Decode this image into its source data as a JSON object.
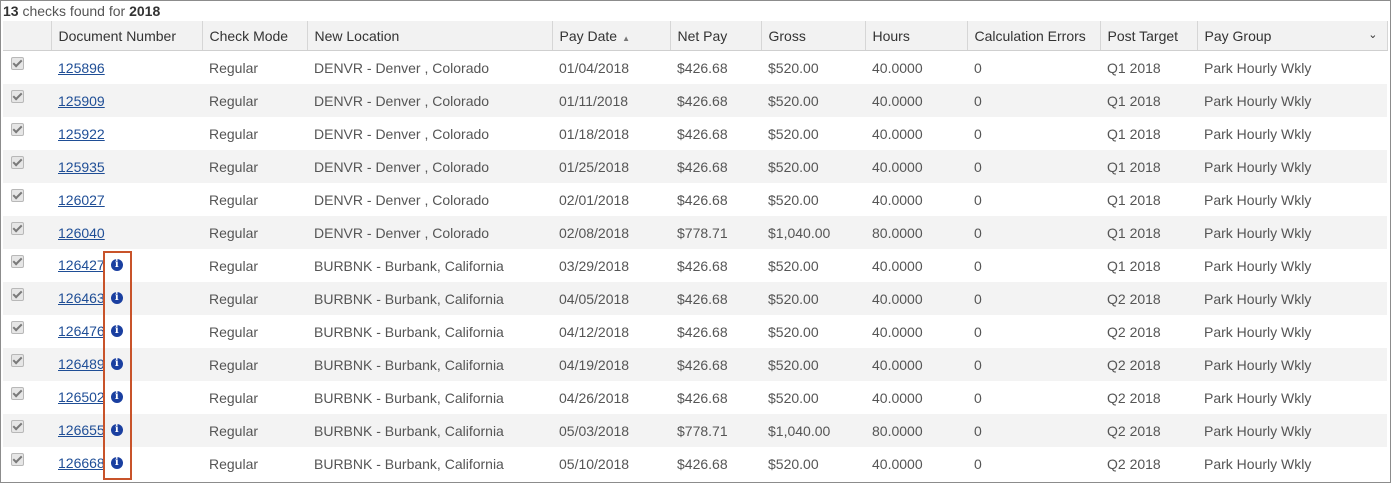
{
  "summary": {
    "count": "13",
    "text": " checks found for ",
    "year": "2018"
  },
  "columns": [
    "Document Number",
    "Check Mode",
    "New Location",
    "Pay Date",
    "Net Pay",
    "Gross",
    "Hours",
    "Calculation Errors",
    "Post Target",
    "Pay Group"
  ],
  "sort": {
    "column": "Pay Date",
    "direction": "ascending",
    "icon": "sort-up-icon"
  },
  "colors": {
    "link": "#1f4e96",
    "info": "#1a3fa0",
    "highlight": "#c8532a",
    "row_alt": "#f3f3f3"
  },
  "rows": [
    {
      "doc": "125896",
      "mode": "Regular",
      "location": "DENVR - Denver , Colorado",
      "pay_date": "01/04/2018",
      "net": "$426.68",
      "gross": "$520.00",
      "hours": "40.0000",
      "errors": "0",
      "post": "Q1 2018",
      "group": "Park Hourly Wkly",
      "info": false
    },
    {
      "doc": "125909",
      "mode": "Regular",
      "location": "DENVR - Denver , Colorado",
      "pay_date": "01/11/2018",
      "net": "$426.68",
      "gross": "$520.00",
      "hours": "40.0000",
      "errors": "0",
      "post": "Q1 2018",
      "group": "Park Hourly Wkly",
      "info": false
    },
    {
      "doc": "125922",
      "mode": "Regular",
      "location": "DENVR - Denver , Colorado",
      "pay_date": "01/18/2018",
      "net": "$426.68",
      "gross": "$520.00",
      "hours": "40.0000",
      "errors": "0",
      "post": "Q1 2018",
      "group": "Park Hourly Wkly",
      "info": false
    },
    {
      "doc": "125935",
      "mode": "Regular",
      "location": "DENVR - Denver , Colorado",
      "pay_date": "01/25/2018",
      "net": "$426.68",
      "gross": "$520.00",
      "hours": "40.0000",
      "errors": "0",
      "post": "Q1 2018",
      "group": "Park Hourly Wkly",
      "info": false
    },
    {
      "doc": "126027",
      "mode": "Regular",
      "location": "DENVR - Denver , Colorado",
      "pay_date": "02/01/2018",
      "net": "$426.68",
      "gross": "$520.00",
      "hours": "40.0000",
      "errors": "0",
      "post": "Q1 2018",
      "group": "Park Hourly Wkly",
      "info": false
    },
    {
      "doc": "126040",
      "mode": "Regular",
      "location": "DENVR - Denver , Colorado",
      "pay_date": "02/08/2018",
      "net": "$778.71",
      "gross": "$1,040.00",
      "hours": "80.0000",
      "errors": "0",
      "post": "Q1 2018",
      "group": "Park Hourly Wkly",
      "info": false
    },
    {
      "doc": "126427",
      "mode": "Regular",
      "location": "BURBNK - Burbank, California",
      "pay_date": "03/29/2018",
      "net": "$426.68",
      "gross": "$520.00",
      "hours": "40.0000",
      "errors": "0",
      "post": "Q1 2018",
      "group": "Park Hourly Wkly",
      "info": true
    },
    {
      "doc": "126463",
      "mode": "Regular",
      "location": "BURBNK - Burbank, California",
      "pay_date": "04/05/2018",
      "net": "$426.68",
      "gross": "$520.00",
      "hours": "40.0000",
      "errors": "0",
      "post": "Q2 2018",
      "group": "Park Hourly Wkly",
      "info": true
    },
    {
      "doc": "126476",
      "mode": "Regular",
      "location": "BURBNK - Burbank, California",
      "pay_date": "04/12/2018",
      "net": "$426.68",
      "gross": "$520.00",
      "hours": "40.0000",
      "errors": "0",
      "post": "Q2 2018",
      "group": "Park Hourly Wkly",
      "info": true
    },
    {
      "doc": "126489",
      "mode": "Regular",
      "location": "BURBNK - Burbank, California",
      "pay_date": "04/19/2018",
      "net": "$426.68",
      "gross": "$520.00",
      "hours": "40.0000",
      "errors": "0",
      "post": "Q2 2018",
      "group": "Park Hourly Wkly",
      "info": true
    },
    {
      "doc": "126502",
      "mode": "Regular",
      "location": "BURBNK - Burbank, California",
      "pay_date": "04/26/2018",
      "net": "$426.68",
      "gross": "$520.00",
      "hours": "40.0000",
      "errors": "0",
      "post": "Q2 2018",
      "group": "Park Hourly Wkly",
      "info": true
    },
    {
      "doc": "126655",
      "mode": "Regular",
      "location": "BURBNK - Burbank, California",
      "pay_date": "05/03/2018",
      "net": "$778.71",
      "gross": "$1,040.00",
      "hours": "80.0000",
      "errors": "0",
      "post": "Q2 2018",
      "group": "Park Hourly Wkly",
      "info": true
    },
    {
      "doc": "126668",
      "mode": "Regular",
      "location": "BURBNK - Burbank, California",
      "pay_date": "05/10/2018",
      "net": "$426.68",
      "gross": "$520.00",
      "hours": "40.0000",
      "errors": "0",
      "post": "Q2 2018",
      "group": "Park Hourly Wkly",
      "info": true
    }
  ]
}
